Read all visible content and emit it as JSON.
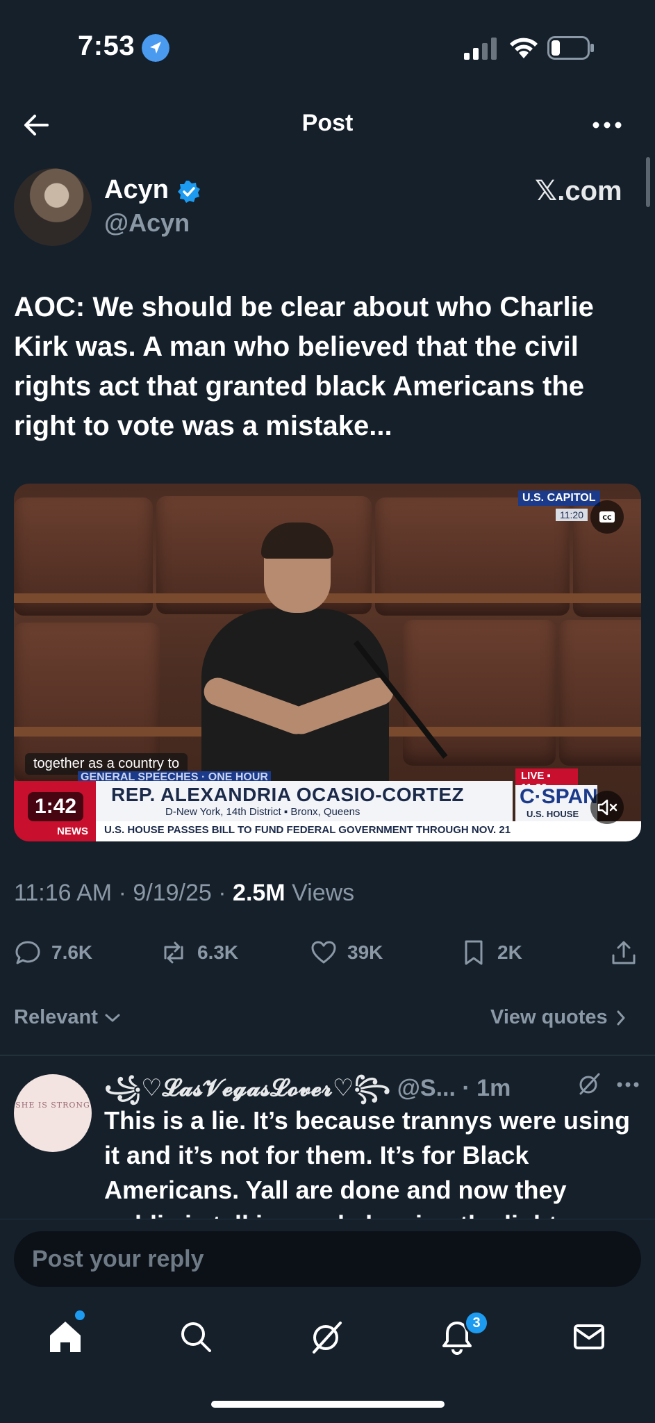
{
  "status_bar": {
    "time": "7:53"
  },
  "nav": {
    "title": "Post"
  },
  "author": {
    "name": "Acyn",
    "handle": "@Acyn"
  },
  "source_label": "𝕏.com",
  "tweet": {
    "text": "AOC: We should be clear about who Charlie Kirk was. A man who believed that the civil rights act that granted black Americans the right to vote was a mistake..."
  },
  "video": {
    "duration": "1:42",
    "caption": "together as a country to",
    "lower_third": {
      "bar_label": "GENERAL SPEECHES · ONE HOUR",
      "name": "REP. ALEXANDRIA OCASIO-CORTEZ",
      "district": "D-New York, 14th District  ▪  Bronx, Queens",
      "ticker": "U.S. HOUSE PASSES BILL TO FUND FEDERAL GOVERNMENT THROUGH NOV. 21",
      "news": "NEWS",
      "live": "LIVE ▪ 11:20",
      "network": "C·SPAN",
      "network_sub": "U.S. HOUSE"
    },
    "location": "U.S. CAPITOL",
    "location_time": "11:20"
  },
  "meta": {
    "time": "11:16 AM",
    "date": "9/19/25",
    "views_count": "2.5M",
    "views_label": "Views"
  },
  "actions": {
    "replies": "7.6K",
    "reposts": "6.3K",
    "likes": "39K",
    "bookmarks": "2K"
  },
  "sort": {
    "label": "Relevant",
    "view_quotes": "View quotes"
  },
  "reply": {
    "name": "꧁♡𝓛𝓪𝓼𝓥𝓮𝓰𝓪𝓼𝓛𝓸𝓿𝓮𝓻♡꧂",
    "handle": "@S...",
    "time": "1m",
    "avatar_text": "SHE IS STRONG",
    "text": "This is a lie. It’s because trannys were using it and it’s not for them. It’s for Black Americans. Yall are done and now they public is talking and showing the light"
  },
  "composer": {
    "placeholder": "Post your reply"
  },
  "tabs": {
    "notifications_badge": "3"
  },
  "colors": {
    "background": "#15202b",
    "accent": "#1d9bf0",
    "muted": "#8b98a5"
  }
}
